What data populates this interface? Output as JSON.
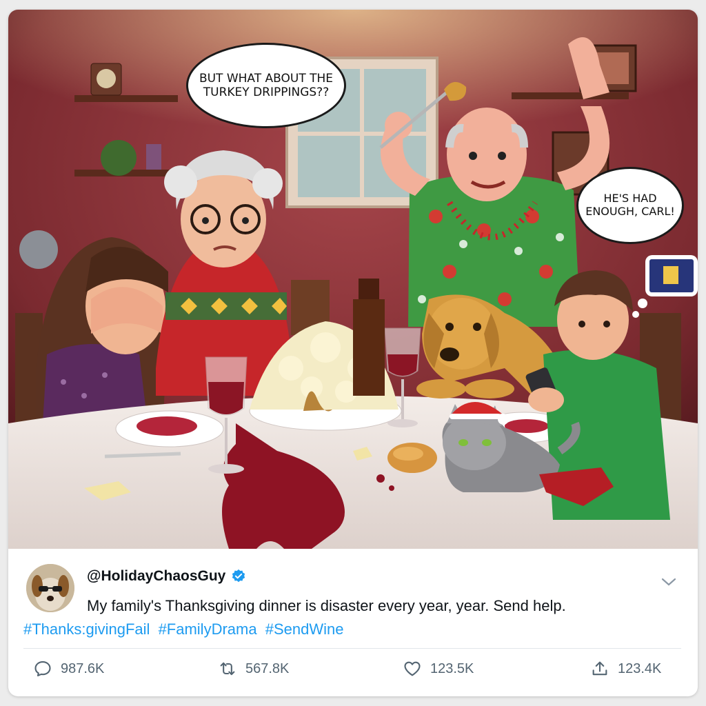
{
  "scene": {
    "speech_grandma": "But what about the turkey drippings??",
    "speech_carl": "He's had enough, Carl!"
  },
  "tweet": {
    "handle": "@HolidayChaosGuy",
    "verified": true,
    "text": "My family's Thanksgiving dinner is disaster every year, year. Send help.",
    "hashtags": [
      "#Thanks:givingFail",
      "#FamilyDrama",
      "#SendWine"
    ]
  },
  "actions": {
    "reply_count": "987.6K",
    "retweet_count": "567.8K",
    "like_count": "123.5K",
    "share_count": "123.4K"
  },
  "colors": {
    "link": "#1d9bf0",
    "verified": "#1d9bf0",
    "action_gray": "#536471"
  },
  "icons": {
    "reply": "reply-icon",
    "retweet": "retweet-icon",
    "like": "heart-icon",
    "share": "share-icon",
    "more": "chevron-down-icon"
  }
}
